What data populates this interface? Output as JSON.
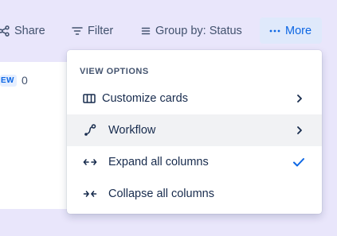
{
  "toolbar": {
    "share_label": "Share",
    "filter_label": "Filter",
    "group_label": "Group by: Status",
    "more_label": "More"
  },
  "column": {
    "badge": "EW",
    "count": "0"
  },
  "menu": {
    "heading": "VIEW OPTIONS",
    "items": [
      {
        "label": "Customize cards",
        "icon": "columns-icon",
        "submenu": true
      },
      {
        "label": "Workflow",
        "icon": "workflow-icon",
        "submenu": true
      },
      {
        "label": "Expand all columns",
        "icon": "expand-arrows-icon",
        "checked": true
      },
      {
        "label": "Collapse all columns",
        "icon": "collapse-arrows-icon",
        "checked": false
      }
    ]
  },
  "colors": {
    "background": "#e9e6fb",
    "accent": "#0c66e4",
    "more_button_bg": "#dfe9fb",
    "hover_row": "#f1f2f4"
  }
}
